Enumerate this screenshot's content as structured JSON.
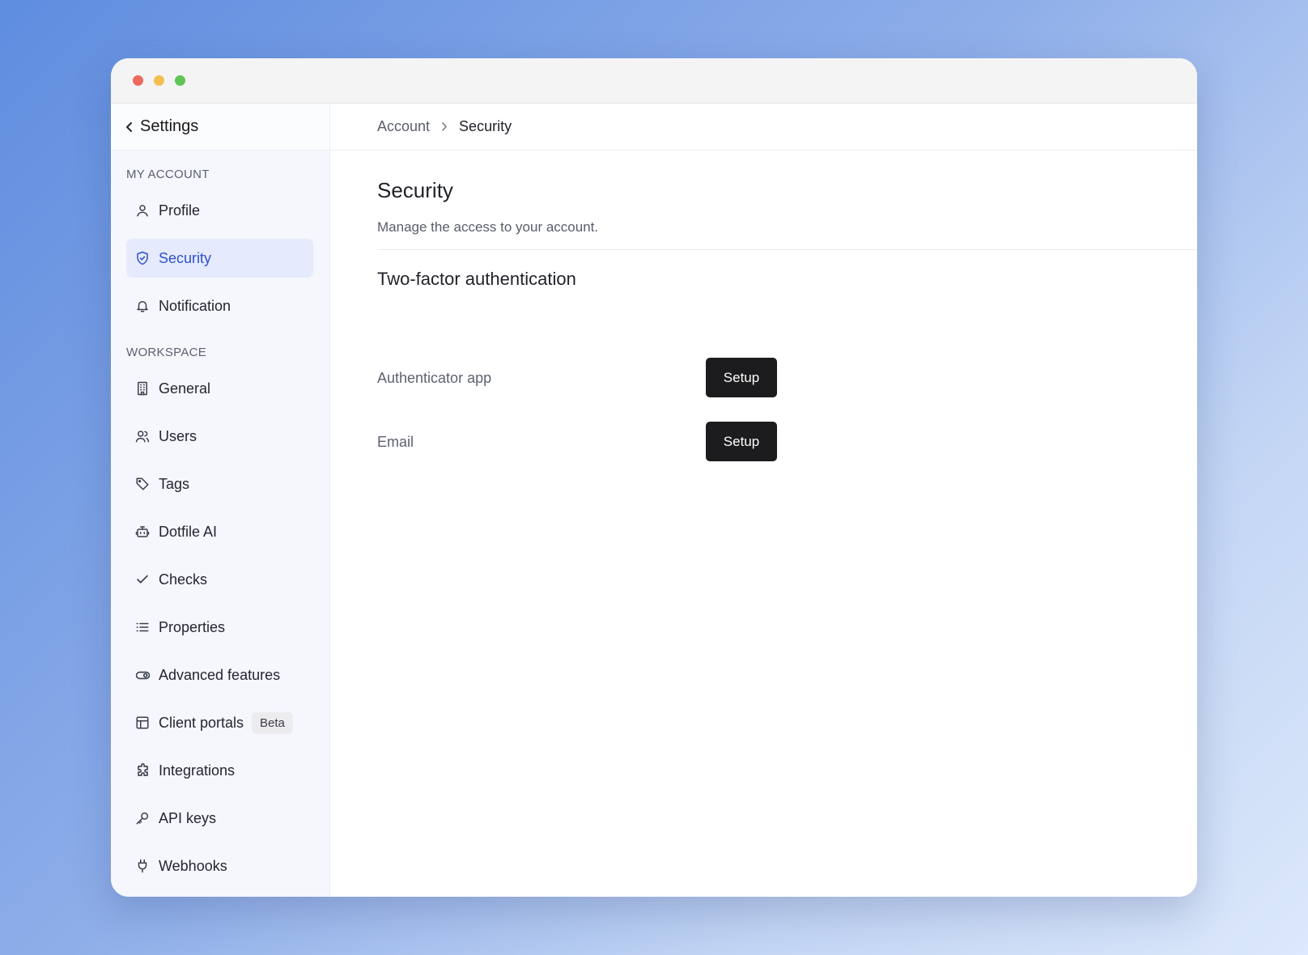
{
  "window": {
    "traffic_lights": [
      {
        "name": "close",
        "color": "#ec6a5e"
      },
      {
        "name": "minimize",
        "color": "#f4bf4f"
      },
      {
        "name": "maximize",
        "color": "#61c554"
      }
    ]
  },
  "sidebar": {
    "title": "Settings",
    "back_icon": "chevron-left-icon",
    "sections": [
      {
        "label": "MY ACCOUNT",
        "items": [
          {
            "label": "Profile",
            "icon": "user-icon",
            "active": false
          },
          {
            "label": "Security",
            "icon": "shield-check-icon",
            "active": true
          },
          {
            "label": "Notification",
            "icon": "bell-icon",
            "active": false
          }
        ]
      },
      {
        "label": "WORKSPACE",
        "items": [
          {
            "label": "General",
            "icon": "building-icon",
            "active": false
          },
          {
            "label": "Users",
            "icon": "users-icon",
            "active": false
          },
          {
            "label": "Tags",
            "icon": "tag-icon",
            "active": false
          },
          {
            "label": "Dotfile AI",
            "icon": "bot-icon",
            "active": false
          },
          {
            "label": "Checks",
            "icon": "check-icon",
            "active": false
          },
          {
            "label": "Properties",
            "icon": "list-icon",
            "active": false
          },
          {
            "label": "Advanced features",
            "icon": "toggle-icon",
            "active": false
          },
          {
            "label": "Client portals",
            "icon": "layout-icon",
            "active": false,
            "badge": "Beta"
          },
          {
            "label": "Integrations",
            "icon": "puzzle-icon",
            "active": false
          },
          {
            "label": "API keys",
            "icon": "key-icon",
            "active": false
          },
          {
            "label": "Webhooks",
            "icon": "plug-icon",
            "active": false
          }
        ]
      }
    ]
  },
  "breadcrumb": {
    "parent": "Account",
    "current": "Security"
  },
  "main": {
    "title": "Security",
    "subtitle": "Manage the access to your account.",
    "section_title": "Two-factor authentication",
    "methods": [
      {
        "label": "Authenticator app",
        "button": "Setup"
      },
      {
        "label": "Email",
        "button": "Setup"
      }
    ]
  },
  "colors": {
    "accent": "#2f4fd1",
    "active_bg": "#e5ebfc",
    "button_bg": "#1c1c1e"
  }
}
